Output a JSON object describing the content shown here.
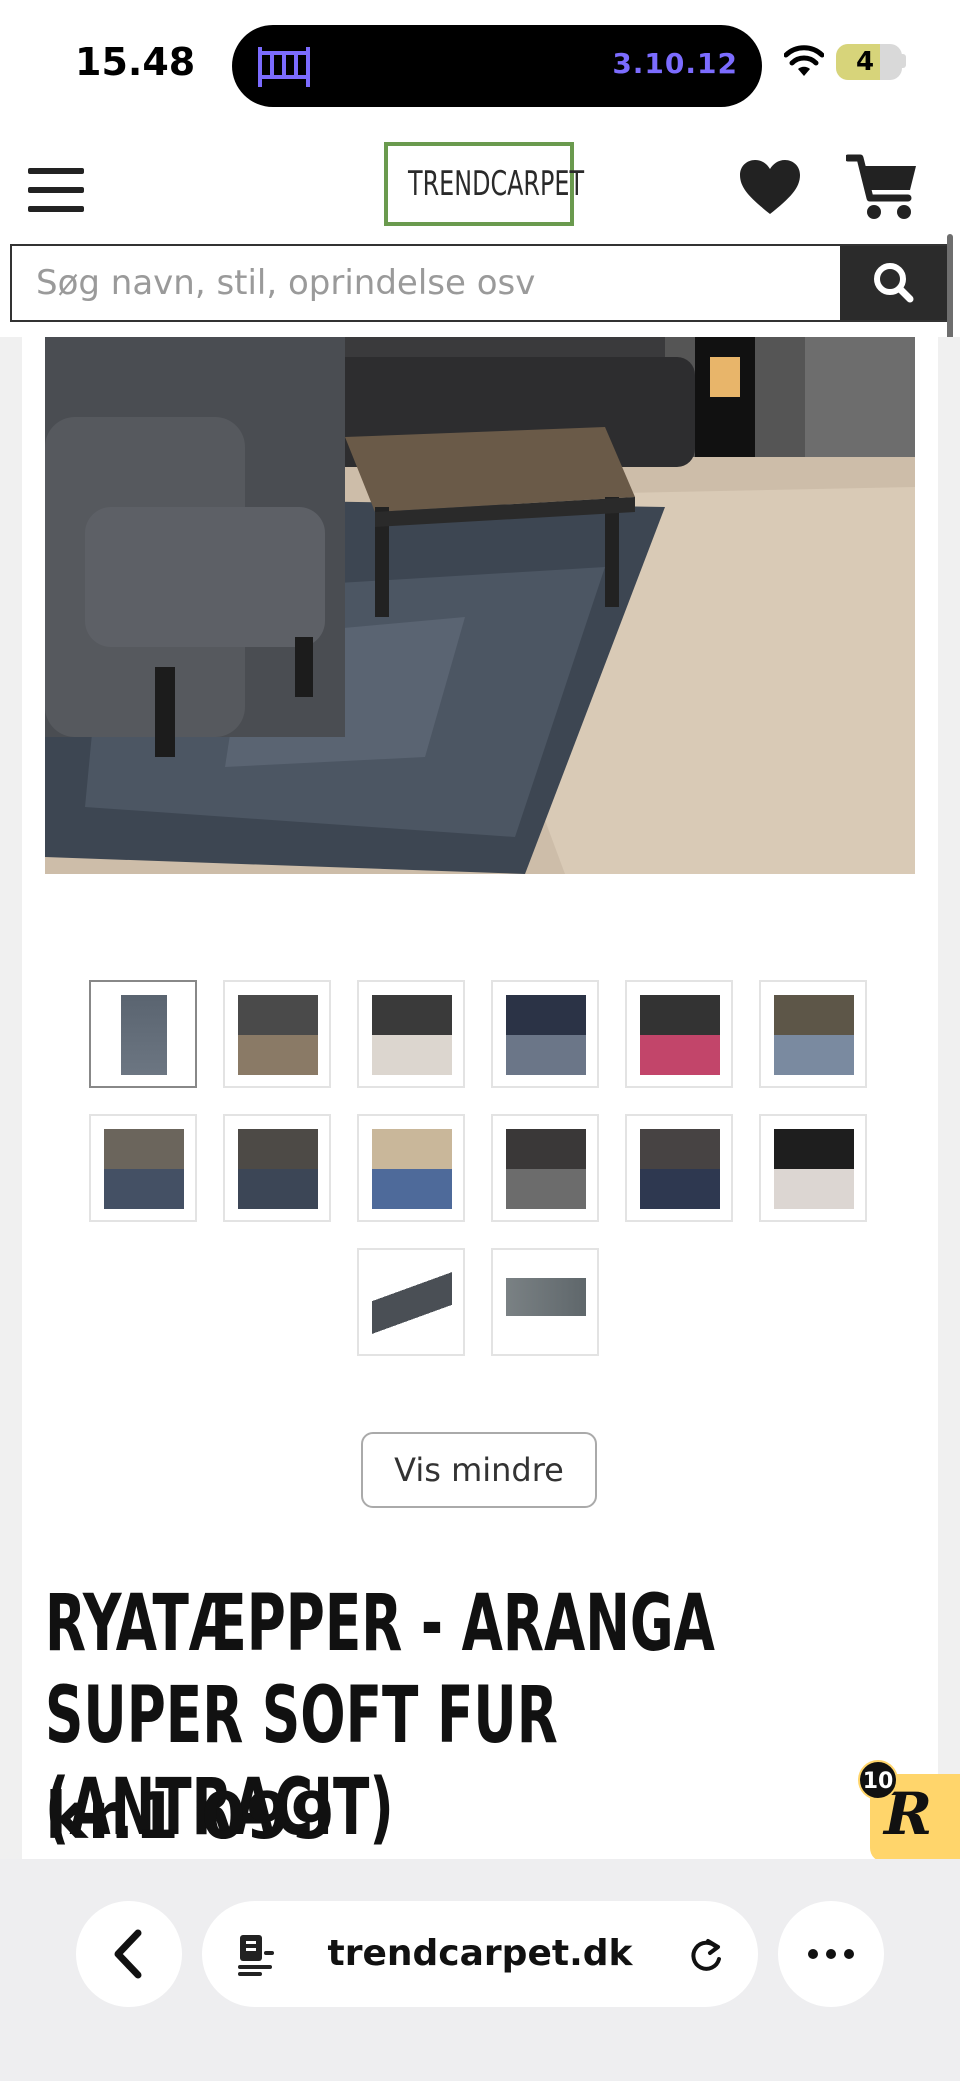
{
  "status_bar": {
    "time": "15.48",
    "island_text": "3.10.12",
    "island_icon": "crib-icon",
    "battery": "4"
  },
  "header": {
    "logo": "TRENDCARPET",
    "search_placeholder": "Søg navn, stil, oprindelse osv",
    "icons": [
      "menu-icon",
      "heart-icon",
      "cart-icon",
      "search-icon"
    ]
  },
  "gallery": {
    "thumbnails_row1": 6,
    "thumbnails_row2": 6,
    "thumbnails_row3": 2,
    "toggle_label": "Vis mindre"
  },
  "product": {
    "title": "RYATÆPPER - ARANGA SUPER SOFT FUR (ANTRACIT)",
    "price": "kr.1 099"
  },
  "badge": {
    "letter": "R",
    "count": "10"
  },
  "browser": {
    "url": "trendcarpet.dk",
    "icons": [
      "back-chevron-icon",
      "reader-icon",
      "reload-icon",
      "more-icon"
    ]
  },
  "colors": {
    "logo_border": "#6a9a4e",
    "badge_bg": "#ffd56b",
    "island_text": "#7c6cff",
    "search_button": "#2b2b2b"
  }
}
